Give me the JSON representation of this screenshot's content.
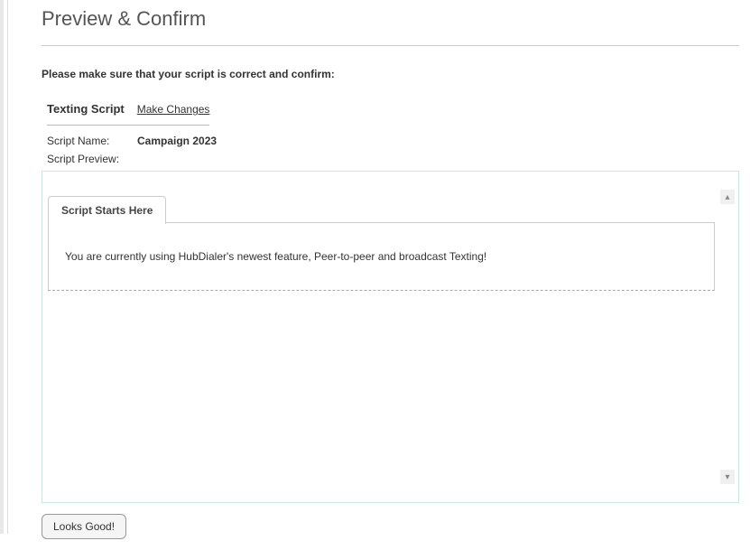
{
  "page": {
    "title": "Preview & Confirm",
    "instruction": "Please make sure that your script is correct and confirm:"
  },
  "section": {
    "title": "Texting Script",
    "make_changes_label": "Make Changes",
    "fields": {
      "script_name_label": "Script Name:",
      "script_name_value": "Campaign 2023",
      "script_preview_label": "Script Preview:"
    }
  },
  "preview": {
    "tab_label": "Script Starts Here",
    "body_text": "You are currently using HubDialer's newest feature, Peer-to-peer and broadcast Texting!"
  },
  "actions": {
    "confirm_label": "Looks Good!"
  },
  "icons": {
    "scroll_up": "▴",
    "scroll_down": "▾"
  }
}
